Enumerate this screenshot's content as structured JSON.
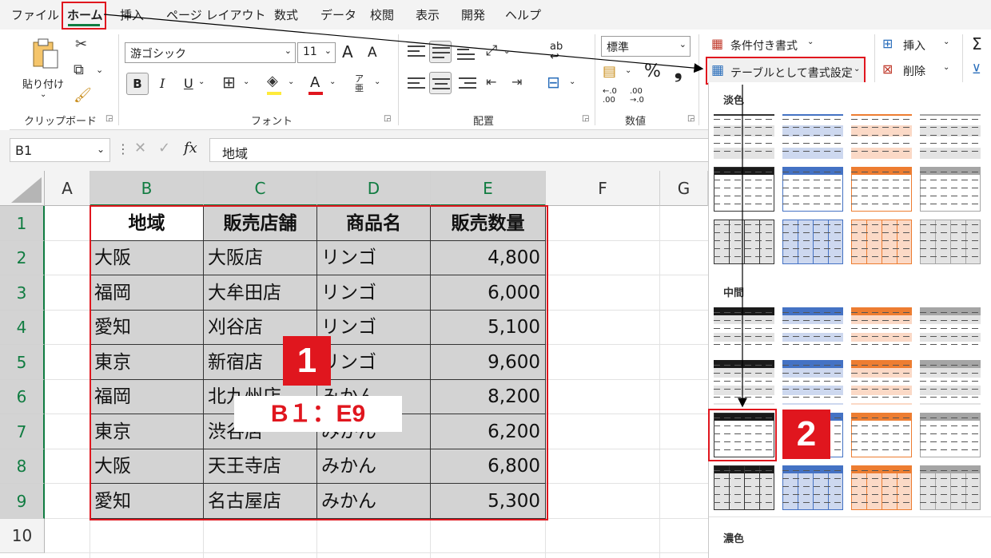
{
  "menu": {
    "items": [
      "ファイル",
      "ホーム",
      "挿入",
      "ページ レイアウト",
      "数式",
      "データ",
      "校閲",
      "表示",
      "開発",
      "ヘルプ"
    ]
  },
  "ribbon": {
    "clipboard": {
      "paste_label": "貼り付け",
      "group_label": "クリップボード"
    },
    "font": {
      "font_name": "游ゴシック",
      "font_size": "11",
      "grow": "A",
      "shrink": "A",
      "bold": "B",
      "italic": "I",
      "underline": "U",
      "color_a": "A",
      "phonetic": "ア亜",
      "group_label": "フォント"
    },
    "alignment": {
      "wrap": "ab",
      "group_label": "配置"
    },
    "number": {
      "format": "標準",
      "percent": "%",
      "comma": "❟",
      "inc_decimal": "←.0 .00",
      "dec_decimal": ".00 →.0",
      "group_label": "数値"
    },
    "styles": {
      "conditional": "条件付き書式",
      "as_table": "テーブルとして書式設定"
    },
    "cells": {
      "insert": "挿入",
      "delete": "削除"
    },
    "edit": {
      "sum": "Σ"
    }
  },
  "formula_bar": {
    "name_box": "B1",
    "fx": "fx",
    "value": "地域"
  },
  "sheet": {
    "columns": [
      "A",
      "B",
      "C",
      "D",
      "E",
      "F",
      "G"
    ],
    "rows": [
      "1",
      "2",
      "3",
      "4",
      "5",
      "6",
      "7",
      "8",
      "9",
      "10"
    ],
    "header": [
      "地域",
      "販売店舗",
      "商品名",
      "販売数量"
    ],
    "data": [
      [
        "大阪",
        "大阪店",
        "リンゴ",
        "4,800"
      ],
      [
        "福岡",
        "大牟田店",
        "リンゴ",
        "6,000"
      ],
      [
        "愛知",
        "刈谷店",
        "リンゴ",
        "5,100"
      ],
      [
        "東京",
        "新宿店",
        "リンゴ",
        "9,600"
      ],
      [
        "福岡",
        "北九州店",
        "みかん",
        "8,200"
      ],
      [
        "東京",
        "渋谷店",
        "みかん",
        "6,200"
      ],
      [
        "大阪",
        "天王寺店",
        "みかん",
        "6,800"
      ],
      [
        "愛知",
        "名古屋店",
        "みかん",
        "5,300"
      ]
    ]
  },
  "annotations": {
    "badge1": "1",
    "badge2": "2",
    "range": "B１：E9"
  },
  "gallery": {
    "sections": [
      "淡色",
      "中間",
      "濃色"
    ],
    "colors": {
      "black": "#1a1a1a",
      "blue": "#4472c4",
      "orange": "#ed7d31",
      "gray": "#a5a5a5",
      "light_blue": "#cdd8ef",
      "light_orange": "#fbd9c6",
      "light_gray": "#e3e3e3"
    }
  },
  "colors": {
    "accent_red": "#e0161e",
    "excel_green": "#107c41",
    "selection_fill": "#d3d3d3"
  }
}
